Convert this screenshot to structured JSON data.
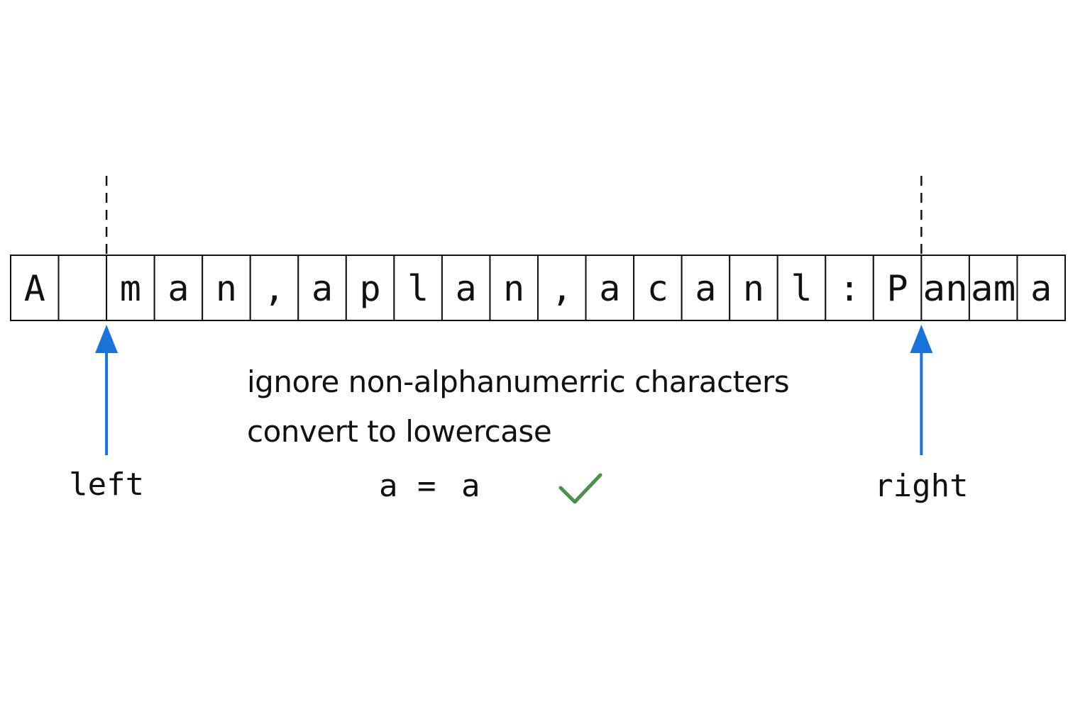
{
  "cells": [
    "A",
    "",
    "m",
    "a",
    "n",
    ",",
    "a",
    "p",
    "l",
    "a",
    "n",
    ",",
    "a",
    "c",
    "a",
    "n",
    "l",
    ":",
    "P",
    "an",
    "am",
    "a"
  ],
  "pointers": {
    "left": {
      "label": "left",
      "index": 2
    },
    "right": {
      "label": "right",
      "index": 19
    }
  },
  "notes": [
    "ignore non-alphanumerric characters",
    "convert to lowercase"
  ],
  "comparison": {
    "left_char": "a",
    "operator": "=",
    "right_char": "a",
    "result_icon": "checkmark-icon"
  },
  "colors": {
    "pointer": "#1a73d9",
    "check": "#4f8f4a",
    "stroke": "#111111"
  }
}
